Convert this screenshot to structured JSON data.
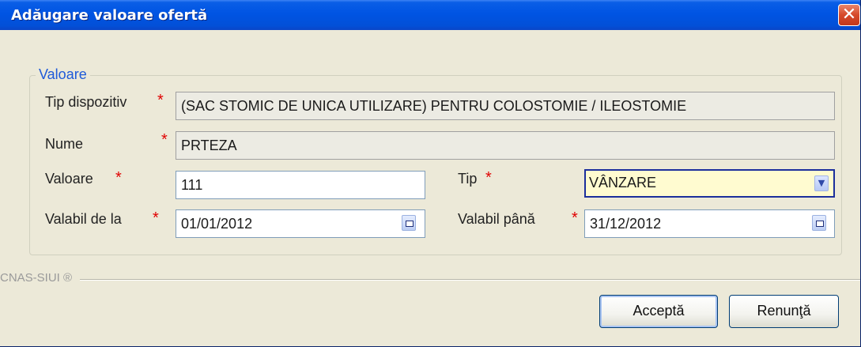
{
  "window": {
    "title": "Adăugare valoare ofertă"
  },
  "group": {
    "legend": "Valoare"
  },
  "fields": {
    "tip_dispozitiv": {
      "label": "Tip dispozitiv",
      "value": "(SAC STOMIC DE UNICA UTILIZARE) PENTRU COLOSTOMIE / ILEOSTOMIE"
    },
    "nume": {
      "label": "Nume",
      "value": "PRTEZA"
    },
    "valoare": {
      "label": "Valoare",
      "value": "111"
    },
    "tip": {
      "label": "Tip",
      "value": "VÂNZARE"
    },
    "valabil_de_la": {
      "label": "Valabil de la",
      "value": "01/01/2012"
    },
    "valabil_pana": {
      "label": "Valabil până",
      "value": "31/12/2012"
    }
  },
  "required_mark": "*",
  "footer": {
    "brand": "CNAS-SIUI ®"
  },
  "buttons": {
    "accept": "Acceptă",
    "cancel": "Renunţă"
  },
  "colors": {
    "title_bar": "#0054e3",
    "required": "#e00000",
    "legend": "#1e5ad9",
    "window_bg": "#ece9d8"
  }
}
